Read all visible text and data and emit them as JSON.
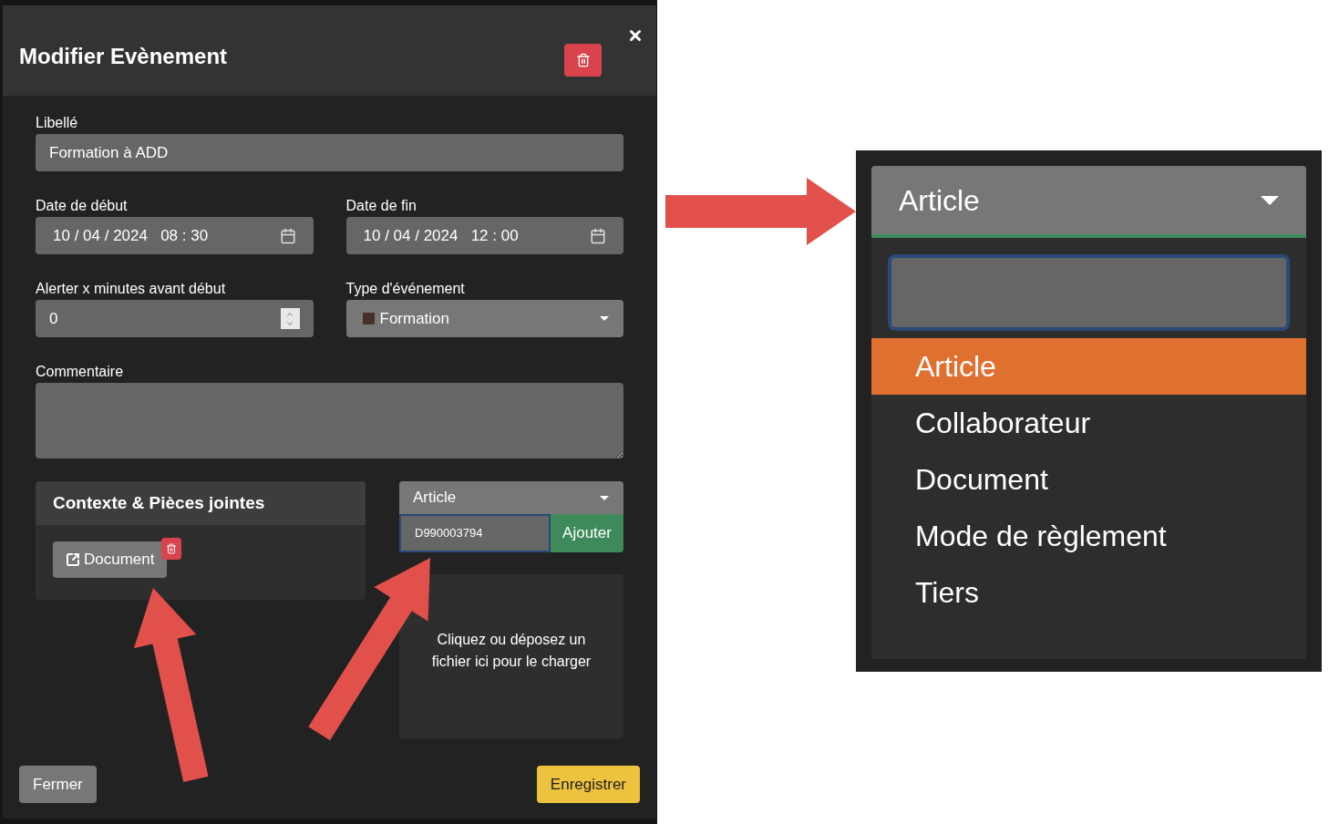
{
  "dialog": {
    "title": "Modifier Evènement",
    "libelle": {
      "label": "Libellé",
      "value": "Formation à ADD"
    },
    "date_start": {
      "label": "Date de début",
      "value": "10 / 04 / 2024   08 : 30"
    },
    "date_end": {
      "label": "Date de fin",
      "value": "10 / 04 / 2024   12 : 00"
    },
    "alert": {
      "label": "Alerter x minutes avant début",
      "value": "0"
    },
    "event_type": {
      "label": "Type d'événement",
      "value": "Formation",
      "color": "#4a2e28"
    },
    "comment": {
      "label": "Commentaire"
    },
    "context": {
      "title": "Contexte & Pièces jointes",
      "attachments": [
        {
          "label": "Document"
        }
      ]
    },
    "link_form": {
      "type": "Article",
      "value": "D990003794",
      "focused": true,
      "add_button": "Ajouter"
    },
    "dropzone": "Cliquez ou déposez un fichier ici pour le charger",
    "footer": {
      "close": "Fermer",
      "save": "Enregistrer"
    }
  },
  "zoom_inset": {
    "select_value": "Article",
    "options": [
      {
        "label": "Article",
        "selected": true
      },
      {
        "label": "Collaborateur",
        "selected": false
      },
      {
        "label": "Document",
        "selected": false
      },
      {
        "label": "Mode de règlement",
        "selected": false
      },
      {
        "label": "Tiers",
        "selected": false
      }
    ]
  }
}
